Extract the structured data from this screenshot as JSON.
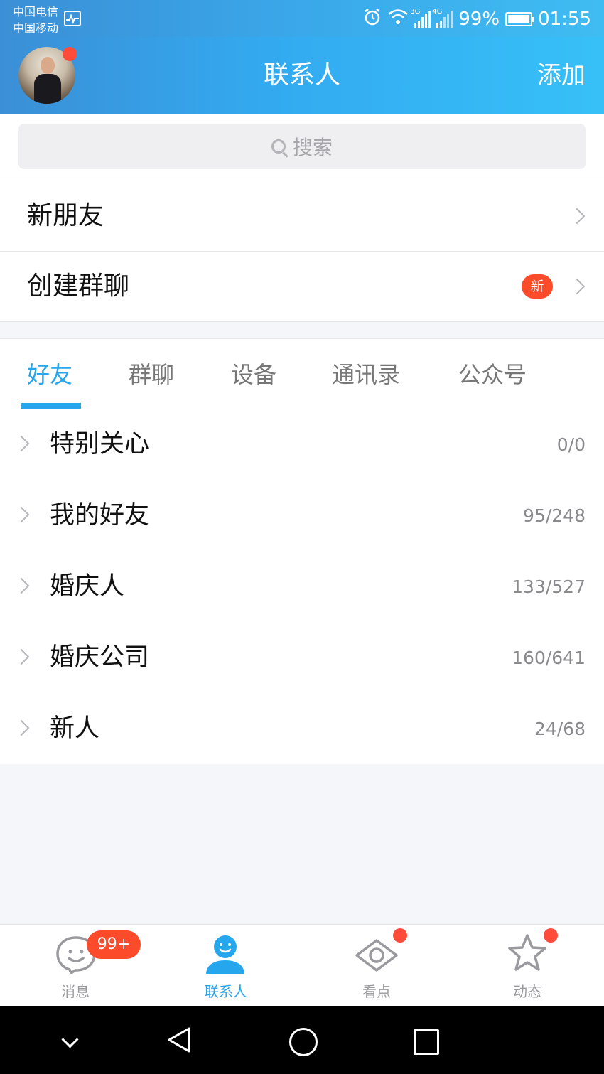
{
  "status_bar": {
    "carrier_1": "中国电信",
    "carrier_2": "中国移动",
    "net_1": "3G",
    "net_2": "4G",
    "battery": "99%",
    "time": "01:55"
  },
  "header": {
    "title": "联系人",
    "add_label": "添加"
  },
  "search": {
    "placeholder": "搜索"
  },
  "menu": {
    "new_friends": "新朋友",
    "create_group": "创建群聊",
    "create_group_badge": "新"
  },
  "tabs": [
    {
      "label": "好友",
      "active": true
    },
    {
      "label": "群聊",
      "active": false
    },
    {
      "label": "设备",
      "active": false
    },
    {
      "label": "通讯录",
      "active": false
    },
    {
      "label": "公众号",
      "active": false
    }
  ],
  "groups": [
    {
      "name": "特别关心",
      "count": "0/0"
    },
    {
      "name": "我的好友",
      "count": "95/248"
    },
    {
      "name": "婚庆人",
      "count": "133/527"
    },
    {
      "name": "婚庆公司",
      "count": "160/641"
    },
    {
      "name": "新人",
      "count": "24/68"
    }
  ],
  "bottom_nav": [
    {
      "label": "消息",
      "badge": "99+",
      "icon": "message-icon"
    },
    {
      "label": "联系人",
      "icon": "contacts-icon",
      "active": true
    },
    {
      "label": "看点",
      "icon": "eye-icon"
    },
    {
      "label": "动态",
      "icon": "star-icon"
    }
  ],
  "colors": {
    "accent": "#26a6ec",
    "header_start": "#3b8fd6",
    "header_end": "#37c0f8",
    "badge": "#fb4b2b"
  }
}
